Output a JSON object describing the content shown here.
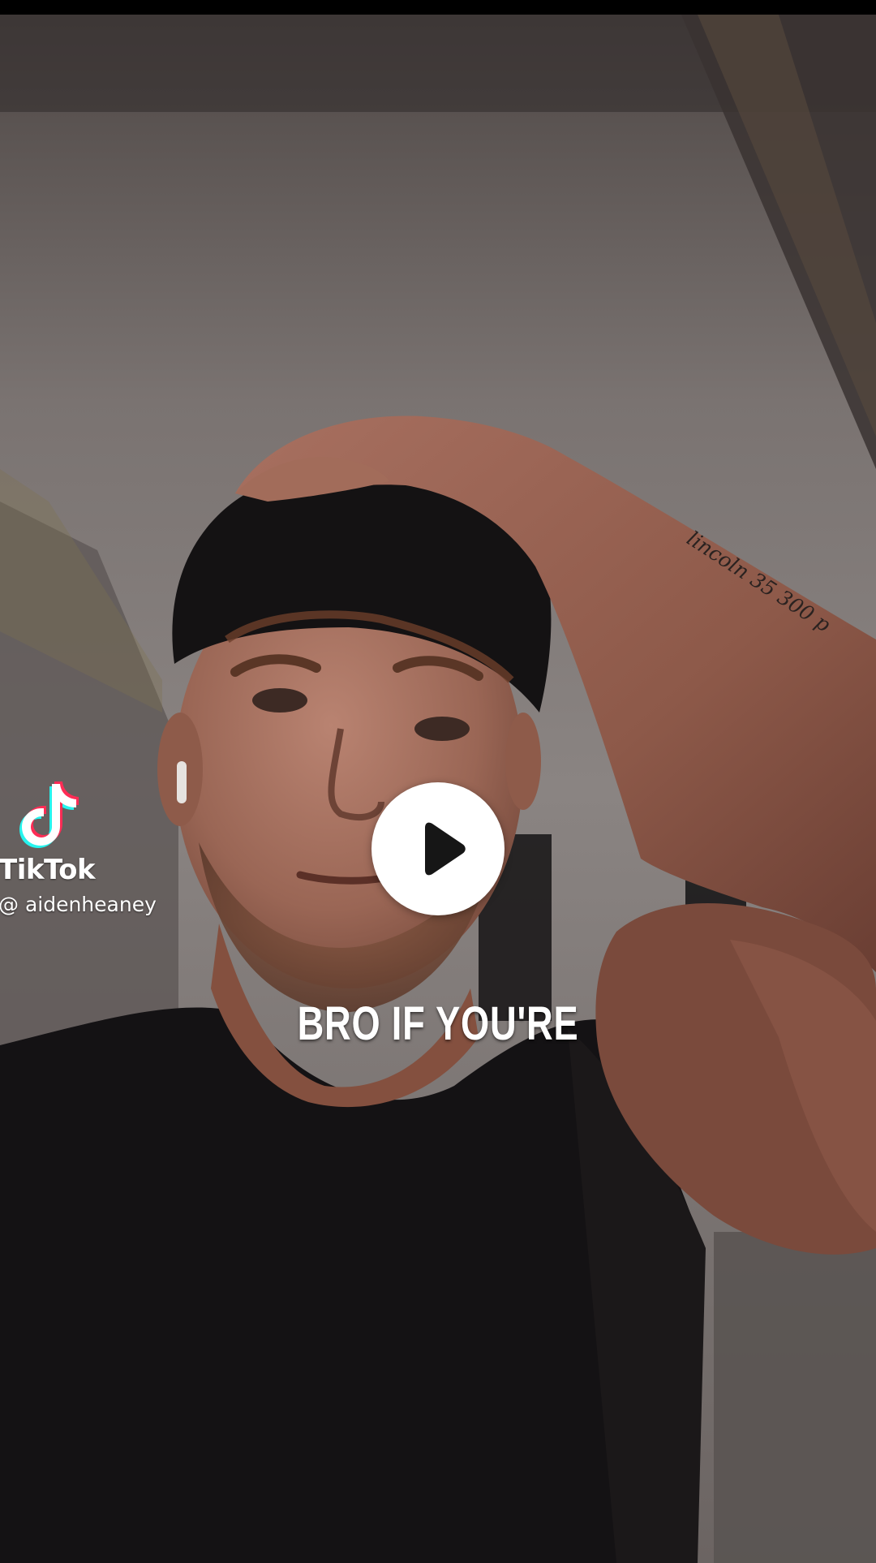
{
  "video": {
    "caption": "BRO IF YOU'RE",
    "tattoo_text": "lincoln 35 300 p",
    "state": "paused"
  },
  "watermark": {
    "brand": "TikTok",
    "handle": "@ aidenheaney",
    "logo_icon": "tiktok-note-icon"
  },
  "controls": {
    "play_icon": "play-icon",
    "play_label": "Play"
  },
  "colors": {
    "wall": "#6f6866",
    "shirt": "#141214",
    "skin": "#a06c5a",
    "tiktok_cyan": "#25f4ee",
    "tiktok_red": "#fe2c55"
  }
}
